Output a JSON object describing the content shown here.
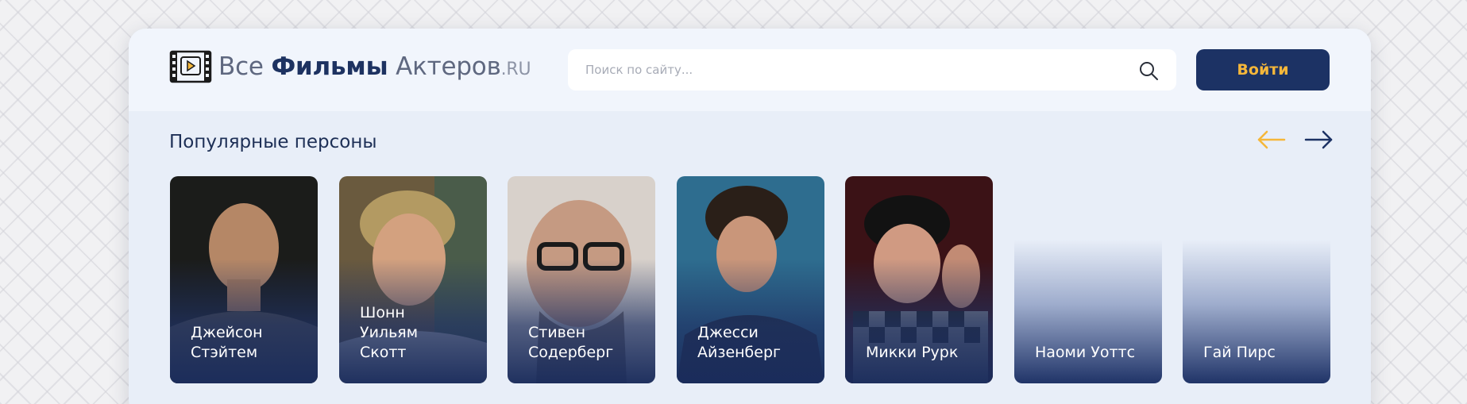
{
  "logo": {
    "part1": "Все",
    "part2": "Фильмы",
    "part3": "Актеров",
    "part4": ".RU"
  },
  "search": {
    "placeholder": "Поиск по сайту..."
  },
  "header": {
    "login_label": "Войти"
  },
  "section": {
    "title": "Популярные персоны"
  },
  "colors": {
    "brand_navy": "#1c3264",
    "accent_gold": "#f5b73a"
  },
  "icons": {
    "search": "search-icon",
    "prev": "arrow-left-icon",
    "next": "arrow-right-icon",
    "logo": "film-play-icon"
  },
  "persons": [
    {
      "name": "Джейсон\nСтэйтем"
    },
    {
      "name": "Шонн\nУильям\nСкотт"
    },
    {
      "name": "Стивен\nСодерберг"
    },
    {
      "name": "Джесси\nАйзенберг"
    },
    {
      "name": "Микки Рурк"
    },
    {
      "name": "Наоми Уоттс"
    },
    {
      "name": "Гай Пирс"
    }
  ]
}
